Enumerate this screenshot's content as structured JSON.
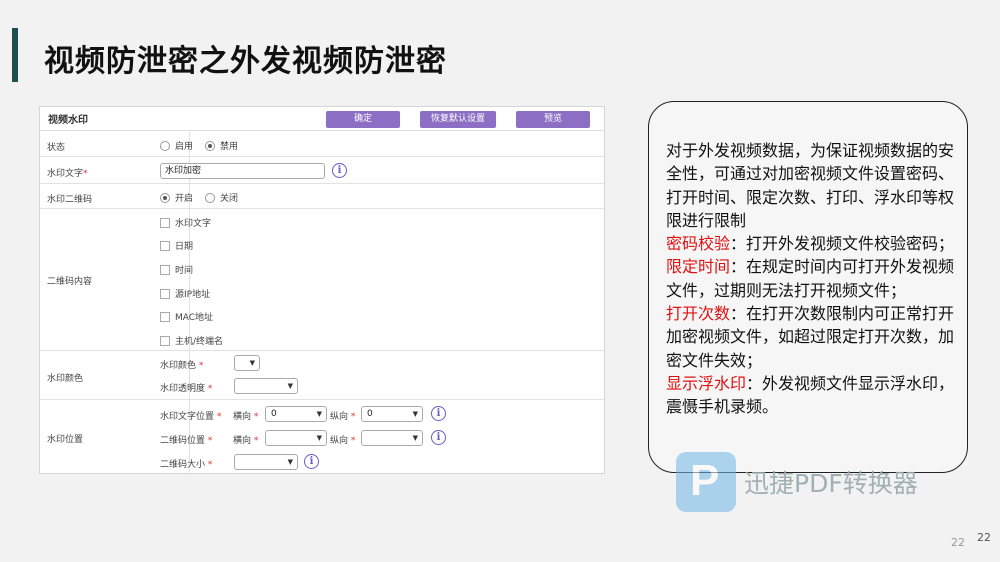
{
  "slide": {
    "title": "视频防泄密之外发视频防泄密",
    "page_number_faint": "22",
    "page_number": "22"
  },
  "panel": {
    "name": "视频水印",
    "buttons": {
      "confirm": "确定",
      "reset": "恢复默认设置",
      "preview": "预览"
    },
    "status": {
      "label": "状态",
      "opt_on": "启用",
      "opt_off": "禁用",
      "selected": "禁用"
    },
    "watermark_text": {
      "label": "水印文字",
      "required_mark": "*",
      "value": "水印加密"
    },
    "qr": {
      "label": "水印二维码",
      "opt_on": "开启",
      "opt_off": "关闭",
      "selected": "开启"
    },
    "qr_content": {
      "label": "二维码内容",
      "items": [
        "水印文字",
        "日期",
        "时间",
        "源IP地址",
        "MAC地址",
        "主机/终端名"
      ]
    },
    "color": {
      "label": "水印颜色",
      "color_label": "水印颜色",
      "opacity_label": "水印透明度",
      "required_mark": "*"
    },
    "position": {
      "label": "水印位置",
      "text_pos_label": "水印文字位置",
      "qr_pos_label": "二维码位置",
      "qr_size_label": "二维码大小",
      "horizontal": "横向",
      "vertical": "纵向",
      "required_mark": "*",
      "text_h_value": "0",
      "text_v_value": "0"
    },
    "info_icon": "i"
  },
  "callout": {
    "intro": "对于外发视频数据，为保证视频数据的安全性，可通过对加密视频文件设置密码、打开时间、限定次数、打印、浮水印等权限进行限制",
    "items": [
      {
        "term": "密码校验",
        "desc": "：打开外发视频文件校验密码；"
      },
      {
        "term": "限定时间",
        "desc": "：在规定时间内可打开外发视频文件，过期则无法打开视频文件；"
      },
      {
        "term": "打开次数",
        "desc": "：在打开次数限制内可正常打开加密视频文件，如超过限定打开次数，加密文件失效；"
      },
      {
        "term": "显示浮水印",
        "desc": "：外发视频文件显示浮水印，震慑手机录频。"
      }
    ]
  },
  "brand": {
    "logo_letter": "P",
    "name": "迅捷PDF转换器"
  },
  "colors": {
    "accent": "#8c6fc4",
    "title_bar": "#1f4e4e",
    "highlight": "#e01010"
  }
}
